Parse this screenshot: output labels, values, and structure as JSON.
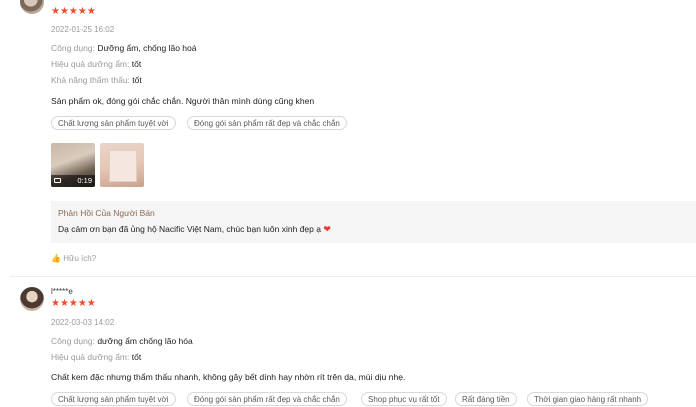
{
  "reviews": [
    {
      "stars": "★★★★★",
      "date": "2022-01-25 16:02",
      "attributes": [
        {
          "key": "Công dụng:",
          "value": "Dưỡng ẩm, chống lão hoá"
        },
        {
          "key": "Hiệu quả dưỡng ẩm:",
          "value": "tốt"
        },
        {
          "key": "Khả năng thẩm thấu:",
          "value": "tốt"
        }
      ],
      "text": "Sản phẩm ok, đóng gói chắc chắn. Người thân mình dùng cũng khen",
      "tags": [
        "Chất lượng sản phẩm tuyệt vời",
        "Đóng gói sản phẩm rất đẹp và chắc chắn"
      ],
      "media": [
        {
          "type": "video",
          "duration": "0:19"
        },
        {
          "type": "image"
        }
      ],
      "seller_reply": {
        "title": "Phản Hồi Của Người Bán",
        "message": "Dạ cảm ơn bạn đã ủng hộ Nacific Việt Nam, chúc bạn luôn xinh đẹp ạ"
      },
      "helpful_label": "Hữu ích?"
    },
    {
      "username": "l*****e",
      "stars": "★★★★★",
      "date": "2022-03-03 14:02",
      "attributes": [
        {
          "key": "Công dụng:",
          "value": "dưỡng ẩm chống lão hóa"
        },
        {
          "key": "Hiệu quả dưỡng ẩm:",
          "value": "tốt"
        }
      ],
      "text": "Chất kem đặc nhưng thẩm thấu nhanh, không gây bết dính hay nhờn rít trên da, mùi dịu nhẹ.",
      "tags": [
        "Chất lượng sản phẩm tuyệt vời",
        "Đóng gói sản phẩm rất đẹp và chắc chắn",
        "Shop phục vụ rất tốt",
        "Rất đáng tiền",
        "Thời gian giao hàng rất nhanh"
      ]
    }
  ],
  "colors": {
    "star": "#ee4d2d",
    "heart": "#e53935",
    "seller_title": "#8a6a55"
  },
  "icons": {
    "helpful": "thumbs-up-icon",
    "video": "video-camera-icon",
    "heart": "heart-icon"
  }
}
